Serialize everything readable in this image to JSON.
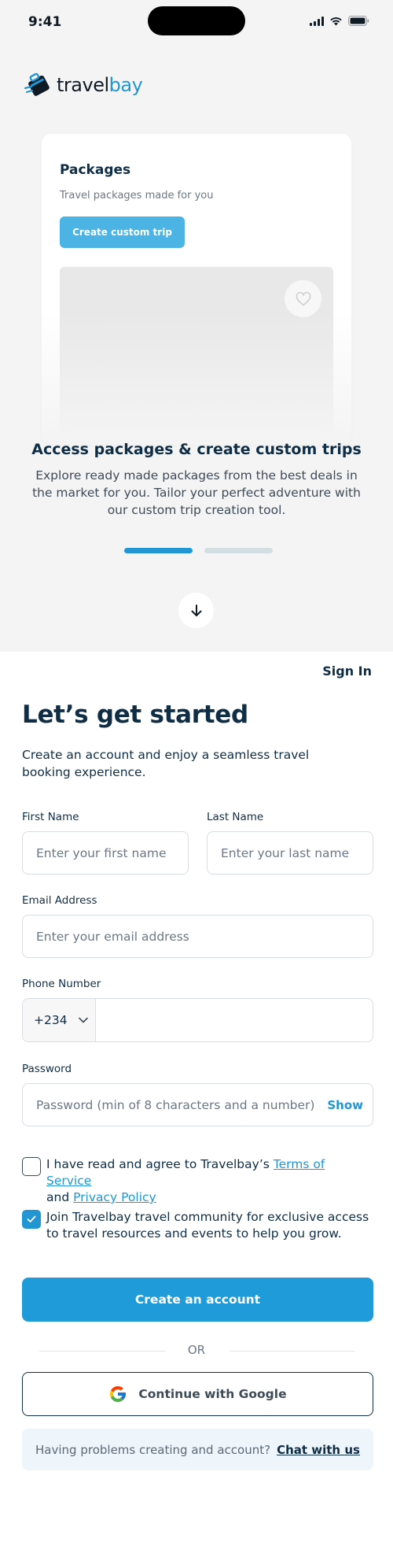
{
  "status_bar": {
    "time": "9:41"
  },
  "brand": {
    "name_part1": "travel",
    "name_part2": "bay"
  },
  "carousel": {
    "card": {
      "title": "Packages",
      "subtitle": "Travel packages made for you",
      "button_label": "Create custom trip"
    },
    "title": "Access packages & create custom trips",
    "description": "Explore ready made packages from the best deals in the market  for you. Tailor your perfect adventure with our custom trip creation tool.",
    "active_slide": 1,
    "slide_count": 2
  },
  "auth": {
    "sign_in_label": "Sign In",
    "heading": "Let’s get started",
    "intro": "Create an account and enjoy a seamless travel booking experience."
  },
  "form": {
    "first_name": {
      "label": "First Name",
      "placeholder": "Enter your first name"
    },
    "last_name": {
      "label": "Last Name",
      "placeholder": "Enter your last name"
    },
    "email": {
      "label": "Email Address",
      "placeholder": "Enter your email address"
    },
    "phone": {
      "label": "Phone Number",
      "country_code": "+234",
      "value": ""
    },
    "password": {
      "label": "Password",
      "placeholder": "Password (min of 8 characters and a number)",
      "toggle_label": "Show"
    },
    "terms": {
      "checked": false,
      "text_before": "I have read and agree to Travelbay’s ",
      "terms_link": "Terms of Service",
      "text_and": "and ",
      "privacy_link": "Privacy Policy"
    },
    "community": {
      "checked": true,
      "text": "Join Travelbay travel community for exclusive access to travel resources and events to help you grow."
    },
    "submit_label": "Create an account",
    "divider_label": "OR",
    "google_label": "Continue with Google"
  },
  "help": {
    "text": "Having problems creating and account?",
    "link": "Chat with us"
  },
  "colors": {
    "primary": "#1E9BD8",
    "accent_light": "#4CB3E5",
    "text_dark": "#0F2D45",
    "background_top": "#F4F4F4",
    "help_bg": "#EEF6FB"
  }
}
